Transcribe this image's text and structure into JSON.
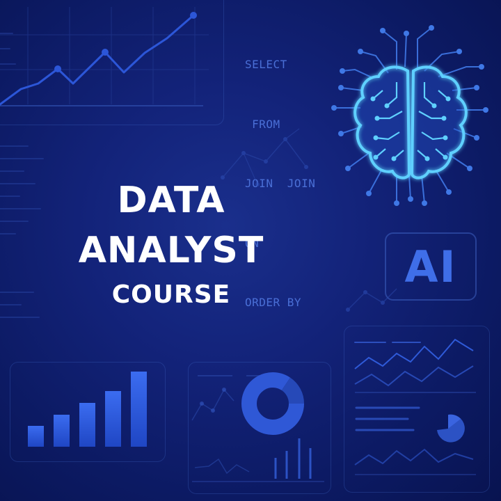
{
  "sql_lines": [
    "SELECT",
    " FROM",
    "JOIN  JOIN",
    "ON",
    "ORDER BY"
  ],
  "title": {
    "line1": "DATA",
    "line2": "ANALYST",
    "line3": "COURSE"
  },
  "badge": {
    "text": "AI"
  },
  "icons": {
    "brain": "brain-circuit-icon",
    "line_chart": "line-chart-icon",
    "bar_chart": "bar-chart-icon",
    "donut_chart": "donut-chart-icon",
    "dashboard": "dashboard-icon",
    "network": "network-graph-icon"
  },
  "colors": {
    "background": "#0c1a63",
    "title": "#ffffff",
    "accent": "#3f6ee8",
    "brain_glow": "#5fd0ff",
    "chart_line": "#2c56d8"
  }
}
